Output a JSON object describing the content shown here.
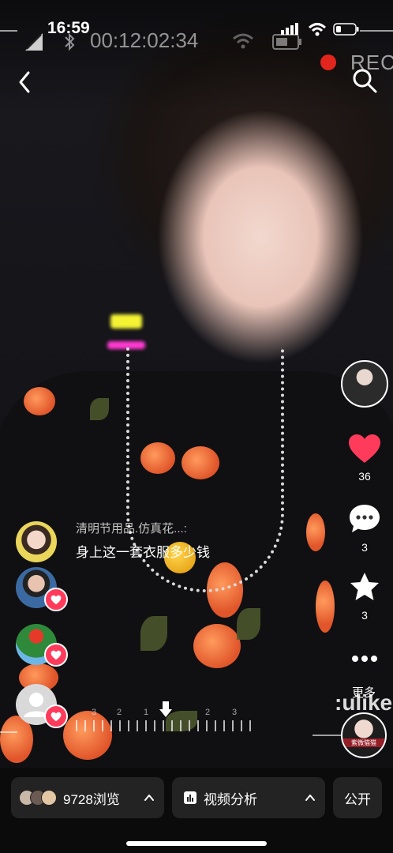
{
  "status_bar": {
    "time": "16:59",
    "recording_timer": "00:12:02:34",
    "rec_label": "REC"
  },
  "nav": {
    "back_icon": "chevron-left-icon",
    "search_icon": "search-icon"
  },
  "right_rail": {
    "like_count": "36",
    "comment_count": "3",
    "favorite_count": "3",
    "more_label": "更多",
    "watermark": ":ulike",
    "bottom_avatar_tag": "紫微猫猫"
  },
  "comment": {
    "username": "清明节用品.仿真花...:",
    "text": "身上这一套衣服多少钱"
  },
  "scrubber": {
    "labels": [
      "3",
      "2",
      "1",
      "2",
      "3"
    ]
  },
  "bottom_bar": {
    "views_label": "9728浏览",
    "analysis_label": "视频分析",
    "visibility_label": "公开"
  },
  "colors": {
    "like_heart": "#ff3b5c",
    "rec_red": "#e2261d",
    "pill_bg": "#232323"
  }
}
